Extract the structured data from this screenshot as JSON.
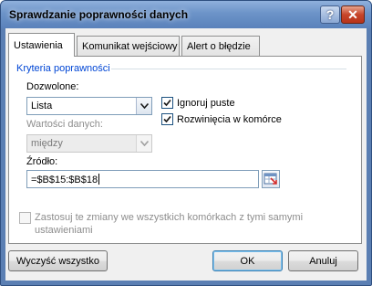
{
  "window": {
    "title": "Sprawdzanie poprawności danych",
    "help_glyph": "?",
    "close_glyph": "✕"
  },
  "tabs": [
    {
      "label": "Ustawienia",
      "active": true
    },
    {
      "label": "Komunikat wejściowy",
      "active": false
    },
    {
      "label": "Alert o błędzie",
      "active": false
    }
  ],
  "criteria": {
    "group_label": "Kryteria poprawności",
    "allow_label": "Dozwolone:",
    "allow_value": "Lista",
    "data_label": "Wartości danych:",
    "data_value": "między",
    "ignore_blank_label": "Ignoruj puste",
    "ignore_blank_checked": true,
    "in_cell_dropdown_label": "Rozwinięcia w komórce",
    "in_cell_dropdown_checked": true,
    "source_label": "Źródło:",
    "source_value": "=$B$15:$B$18"
  },
  "apply_all": {
    "label_line1": "Zastosuj te zmiany we wszystkich komórkach z tymi samymi",
    "label_line2": "ustawieniami",
    "checked": false
  },
  "buttons": {
    "clear_all": "Wyczyść wszystko",
    "ok": "OK",
    "cancel": "Anuluj"
  },
  "colors": {
    "group_label": "#0046d5",
    "title_bar": "#6c93c8",
    "close_button": "#c7452a"
  }
}
